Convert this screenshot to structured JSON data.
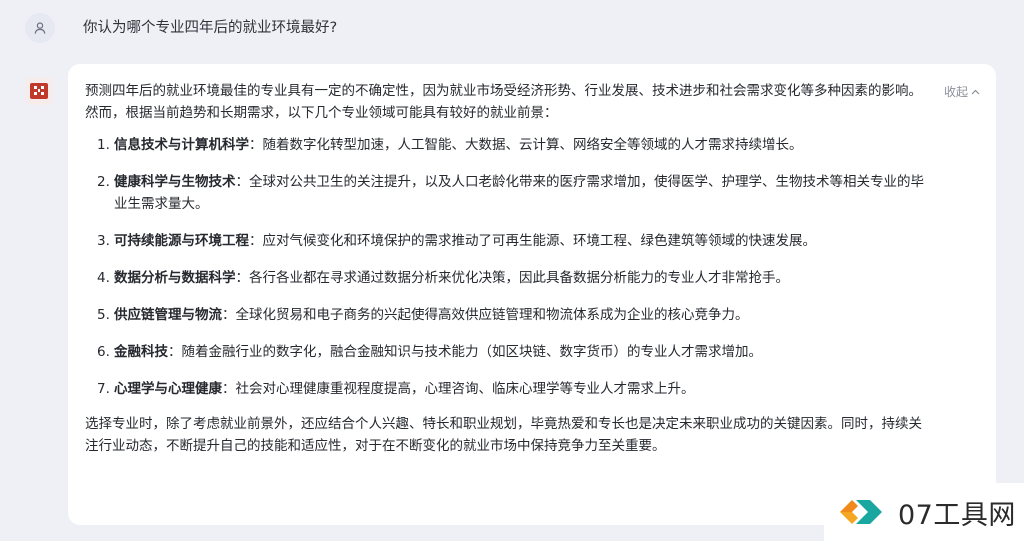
{
  "user": {
    "avatar_icon": "user-icon",
    "question": "你认为哪个专业四年后的就业环境最好?"
  },
  "bot": {
    "avatar_icon": "assistant-logo-icon",
    "collapse_label": "收起",
    "intro": "预测四年后的就业环境最佳的专业具有一定的不确定性，因为就业市场受经济形势、行业发展、技术进步和社会需求变化等多种因素的影响。然而，根据当前趋势和长期需求，以下几个专业领域可能具有较好的就业前景：",
    "items": [
      {
        "num": "1.",
        "term": "信息技术与计算机科学",
        "desc": "：随着数字化转型加速，人工智能、大数据、云计算、网络安全等领域的人才需求持续增长。"
      },
      {
        "num": "2.",
        "term": "健康科学与生物技术",
        "desc": "：全球对公共卫生的关注提升，以及人口老龄化带来的医疗需求增加，使得医学、护理学、生物技术等相关专业的毕业生需求量大。"
      },
      {
        "num": "3.",
        "term": "可持续能源与环境工程",
        "desc": "：应对气候变化和环境保护的需求推动了可再生能源、环境工程、绿色建筑等领域的快速发展。"
      },
      {
        "num": "4.",
        "term": "数据分析与数据科学",
        "desc": "：各行各业都在寻求通过数据分析来优化决策，因此具备数据分析能力的专业人才非常抢手。"
      },
      {
        "num": "5.",
        "term": "供应链管理与物流",
        "desc": "：全球化贸易和电子商务的兴起使得高效供应链管理和物流体系成为企业的核心竞争力。"
      },
      {
        "num": "6.",
        "term": "金融科技",
        "desc": "：随着金融行业的数字化，融合金融知识与技术能力（如区块链、数字货币）的专业人才需求增加。"
      },
      {
        "num": "7.",
        "term": "心理学与心理健康",
        "desc": "：社会对心理健康重视程度提高，心理咨询、临床心理学等专业人才需求上升。"
      }
    ],
    "conclusion": "选择专业时，除了考虑就业前景外，还应结合个人兴趣、特长和职业规划，毕竟热爱和专长也是决定未来职业成功的关键因素。同时，持续关注行业动态，不断提升自己的技能和适应性，对于在不断变化的就业市场中保持竞争力至关重要。"
  },
  "watermark": {
    "text": "07工具网",
    "logo_icon": "watermark-logo-icon",
    "colors": {
      "orange": "#f08a1c",
      "teal": "#1aa7a0"
    }
  },
  "colors": {
    "page_bg": "#eef0f6",
    "card_bg": "#ffffff",
    "text": "#26292f",
    "muted": "#8a8f99"
  }
}
